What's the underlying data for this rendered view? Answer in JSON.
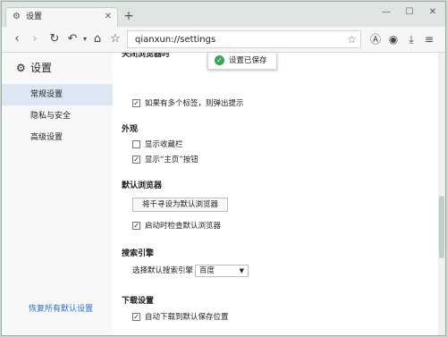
{
  "tab": {
    "title": "设置"
  },
  "toolbar": {
    "url": "qianxun://settings"
  },
  "toast": {
    "text": "设置已保存"
  },
  "sidebar": {
    "title": "设置",
    "items": [
      {
        "label": "常规设置"
      },
      {
        "label": "隐私与安全"
      },
      {
        "label": "高级设置"
      }
    ],
    "reset": "恢复所有默认设置"
  },
  "main": {
    "sec_close": "关闭浏览器时",
    "close_opt": "如果有多个标签，则弹出提示",
    "sec_appearance": "外观",
    "show_bookmarks": "显示收藏栏",
    "show_home": "显示“主页”按钮",
    "sec_default": "默认浏览器",
    "set_default_btn": "将千寻设为默认浏览器",
    "check_default": "启动时检查默认浏览器",
    "sec_search": "搜索引擎",
    "search_label": "选择默认搜索引擎",
    "search_value": "百度",
    "sec_download": "下载设置",
    "download_opt": "自动下载到默认保存位置"
  }
}
